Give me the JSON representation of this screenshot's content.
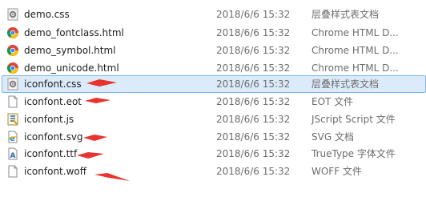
{
  "files": [
    {
      "name": "demo.css",
      "date": "2018/6/6 15:32",
      "type": "层叠样式表文档",
      "icon": "css-gear-icon"
    },
    {
      "name": "demo_fontclass.html",
      "date": "2018/6/6 15:32",
      "type": "Chrome HTML D...",
      "icon": "chrome-icon"
    },
    {
      "name": "demo_symbol.html",
      "date": "2018/6/6 15:32",
      "type": "Chrome HTML D...",
      "icon": "chrome-icon"
    },
    {
      "name": "demo_unicode.html",
      "date": "2018/6/6 15:32",
      "type": "Chrome HTML D...",
      "icon": "chrome-icon"
    },
    {
      "name": "iconfont.css",
      "date": "2018/6/6 15:32",
      "type": "层叠样式表文档",
      "icon": "css-gear-icon"
    },
    {
      "name": "iconfont.eot",
      "date": "2018/6/6 15:32",
      "type": "EOT 文件",
      "icon": "blank-file-icon"
    },
    {
      "name": "iconfont.js",
      "date": "2018/6/6 15:32",
      "type": "JScript Script 文件",
      "icon": "js-script-icon"
    },
    {
      "name": "iconfont.svg",
      "date": "2018/6/6 15:32",
      "type": "SVG 文档",
      "icon": "ie-document-icon"
    },
    {
      "name": "iconfont.ttf",
      "date": "2018/6/6 15:32",
      "type": "TrueType 字体文件",
      "icon": "font-file-icon"
    },
    {
      "name": "iconfont.woff",
      "date": "2018/6/6 15:32",
      "type": "WOFF 文件",
      "icon": "blank-file-icon"
    }
  ],
  "selected_index": 4,
  "colors": {
    "annotation_arrow": "#e8342f",
    "selection_fill": "#dcebfb",
    "selection_border": "#7eb4ea"
  }
}
